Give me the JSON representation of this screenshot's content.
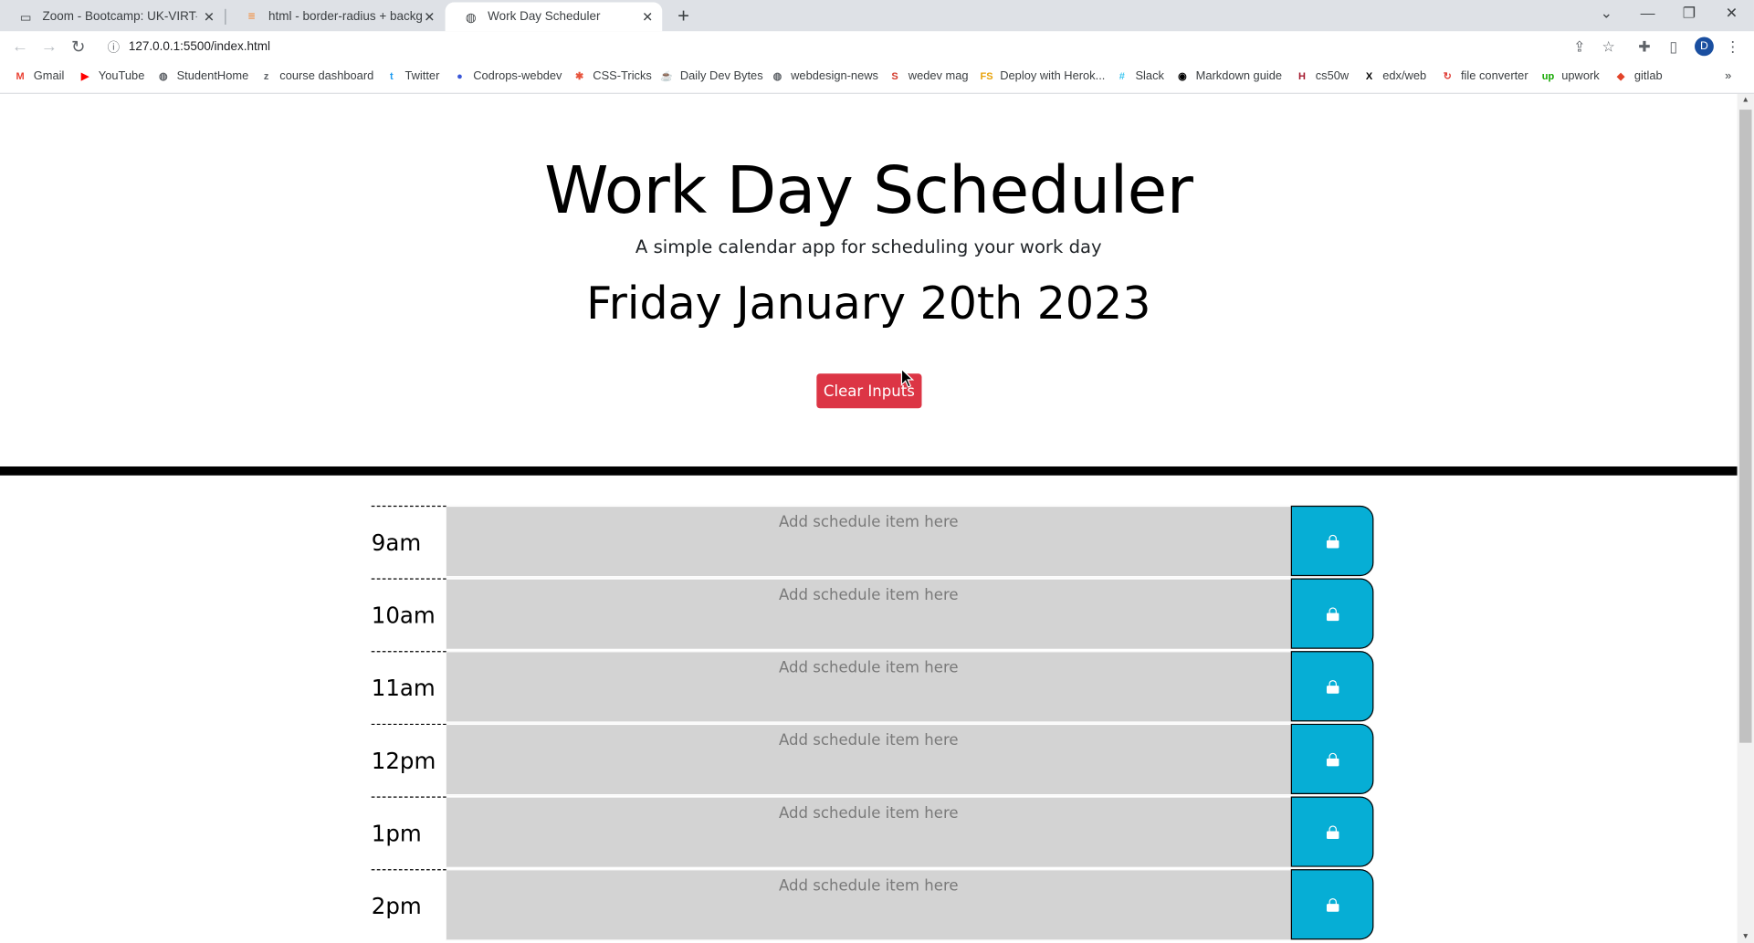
{
  "browser": {
    "tabs": [
      {
        "title": "Zoom - Bootcamp: UK-VIRT-FE-F",
        "icon": "zoom-icon",
        "active": false
      },
      {
        "title": "html - border-radius + backgrou",
        "icon": "stackoverflow-icon",
        "active": false
      },
      {
        "title": "Work Day Scheduler",
        "icon": "globe-icon",
        "active": true
      }
    ],
    "url": "127.0.0.1:5500/index.html",
    "profile_initial": "D",
    "bookmarks": [
      {
        "label": "Gmail",
        "icon": "gmail-icon",
        "color": "#ea4335",
        "glyph": "M"
      },
      {
        "label": "YouTube",
        "icon": "youtube-icon",
        "color": "#ff0000",
        "glyph": "▶"
      },
      {
        "label": "StudentHome",
        "icon": "globe-icon",
        "color": "#5f6368",
        "glyph": "◍"
      },
      {
        "label": "course dashboard",
        "icon": "zoom-icon",
        "color": "#5f6368",
        "glyph": "z"
      },
      {
        "label": "Twitter",
        "icon": "twitter-icon",
        "color": "#1d9bf0",
        "glyph": "t"
      },
      {
        "label": "Codrops-webdev",
        "icon": "codrops-icon",
        "color": "#3a57d8",
        "glyph": "●"
      },
      {
        "label": "CSS-Tricks",
        "icon": "csstricks-icon",
        "color": "#e8553e",
        "glyph": "✱"
      },
      {
        "label": "Daily Dev Bytes",
        "icon": "cup-icon",
        "color": "#c4a35a",
        "glyph": "☕"
      },
      {
        "label": "webdesign-news",
        "icon": "globe-icon",
        "color": "#5f6368",
        "glyph": "◍"
      },
      {
        "label": "wedev mag",
        "icon": "smashing-icon",
        "color": "#d33a2c",
        "glyph": "S"
      },
      {
        "label": "Deploy with Herok...",
        "icon": "heroku-icon",
        "color": "#e8a30c",
        "glyph": "FS"
      },
      {
        "label": "Slack",
        "icon": "slack-icon",
        "color": "#36c5f0",
        "glyph": "#"
      },
      {
        "label": "Markdown guide",
        "icon": "markdown-icon",
        "color": "#000000",
        "glyph": "◉"
      },
      {
        "label": "cs50w",
        "icon": "harvard-icon",
        "color": "#a51c30",
        "glyph": "H"
      },
      {
        "label": "edx/web",
        "icon": "edx-icon",
        "color": "#000000",
        "glyph": "X"
      },
      {
        "label": "file converter",
        "icon": "converter-icon",
        "color": "#e0413a",
        "glyph": "↻"
      },
      {
        "label": "upwork",
        "icon": "upwork-icon",
        "color": "#14a800",
        "glyph": "up"
      },
      {
        "label": "gitlab",
        "icon": "gitlab-icon",
        "color": "#e24329",
        "glyph": "◆"
      }
    ]
  },
  "header": {
    "title": "Work Day Scheduler",
    "lead": "A simple calendar app for scheduling your work day",
    "date": "Friday January 20th 2023",
    "clear_label": "Clear Inputs"
  },
  "colors": {
    "clear_button": "#dc3545",
    "save_button": "#06aed5",
    "textarea_past": "#d3d3d3"
  },
  "schedule": {
    "placeholder": "Add schedule item here",
    "rows": [
      {
        "hour": "9am",
        "text": ""
      },
      {
        "hour": "10am",
        "text": ""
      },
      {
        "hour": "11am",
        "text": ""
      },
      {
        "hour": "12pm",
        "text": ""
      },
      {
        "hour": "1pm",
        "text": ""
      },
      {
        "hour": "2pm",
        "text": ""
      }
    ]
  }
}
